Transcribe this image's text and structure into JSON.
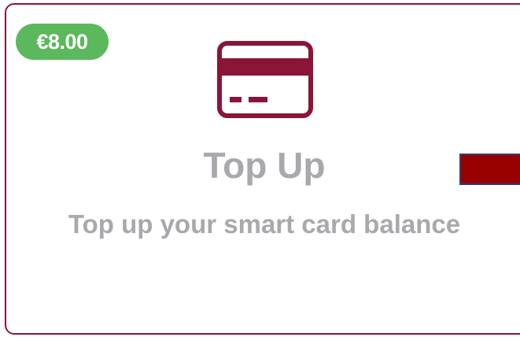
{
  "card": {
    "price": "€8.00",
    "icon": "credit-card-icon",
    "title": "Top Up",
    "subtitle": "Top up your smart card balance"
  },
  "colors": {
    "brand": "#8a1538",
    "badge": "#5cb85c",
    "text": "#a8a8ad",
    "edge_button": "#990000",
    "edge_button_border": "#2e3f7a"
  }
}
